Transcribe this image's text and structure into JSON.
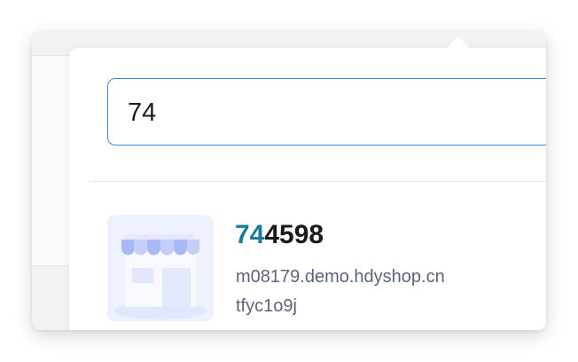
{
  "search": {
    "value": "74"
  },
  "results": [
    {
      "title_highlight": "74",
      "title_rest": "4598",
      "domain": "m08179.demo.hdyshop.cn",
      "code": "tfyc1o9j",
      "thumbnail_icon": "storefront-icon"
    }
  ],
  "colors": {
    "accent_border": "#2f8fe0",
    "highlight_text": "#1e7a9c",
    "secondary_text": "#5b6478",
    "thumbnail_bg": "#eef2fe",
    "awning": "#a9b8f6"
  }
}
